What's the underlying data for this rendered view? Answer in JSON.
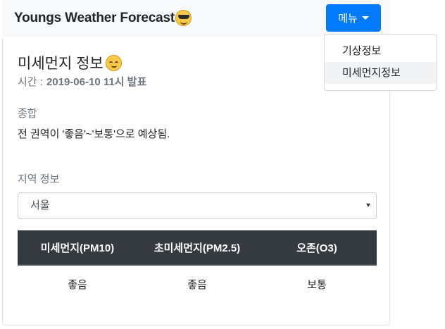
{
  "navbar": {
    "brand": "Youngs Weather Forecast",
    "brand_emoji": "sunglasses-face-icon",
    "menu_button_label": "메뉴"
  },
  "dropdown": {
    "items": [
      {
        "label": "기상정보",
        "active": false
      },
      {
        "label": "미세먼지정보",
        "active": true
      }
    ]
  },
  "card": {
    "title": "미세먼지 정보",
    "title_emoji": "relieved-face-icon",
    "time_label": "시간 :",
    "time_value": "2019-06-10 11시 발표",
    "summary_label": "종합",
    "summary_text": "전 권역이 '좋음'~'보통'으로 예상됨.",
    "region_label": "지역 정보",
    "region_selected": "서울"
  },
  "table": {
    "headers": [
      "미세먼지(PM10)",
      "초미세먼지(PM2.5)",
      "오존(O3)"
    ],
    "values": [
      "좋음",
      "좋음",
      "보통"
    ]
  },
  "colors": {
    "primary": "#007bff",
    "table_header": "#343a40",
    "muted": "#6c757d"
  }
}
